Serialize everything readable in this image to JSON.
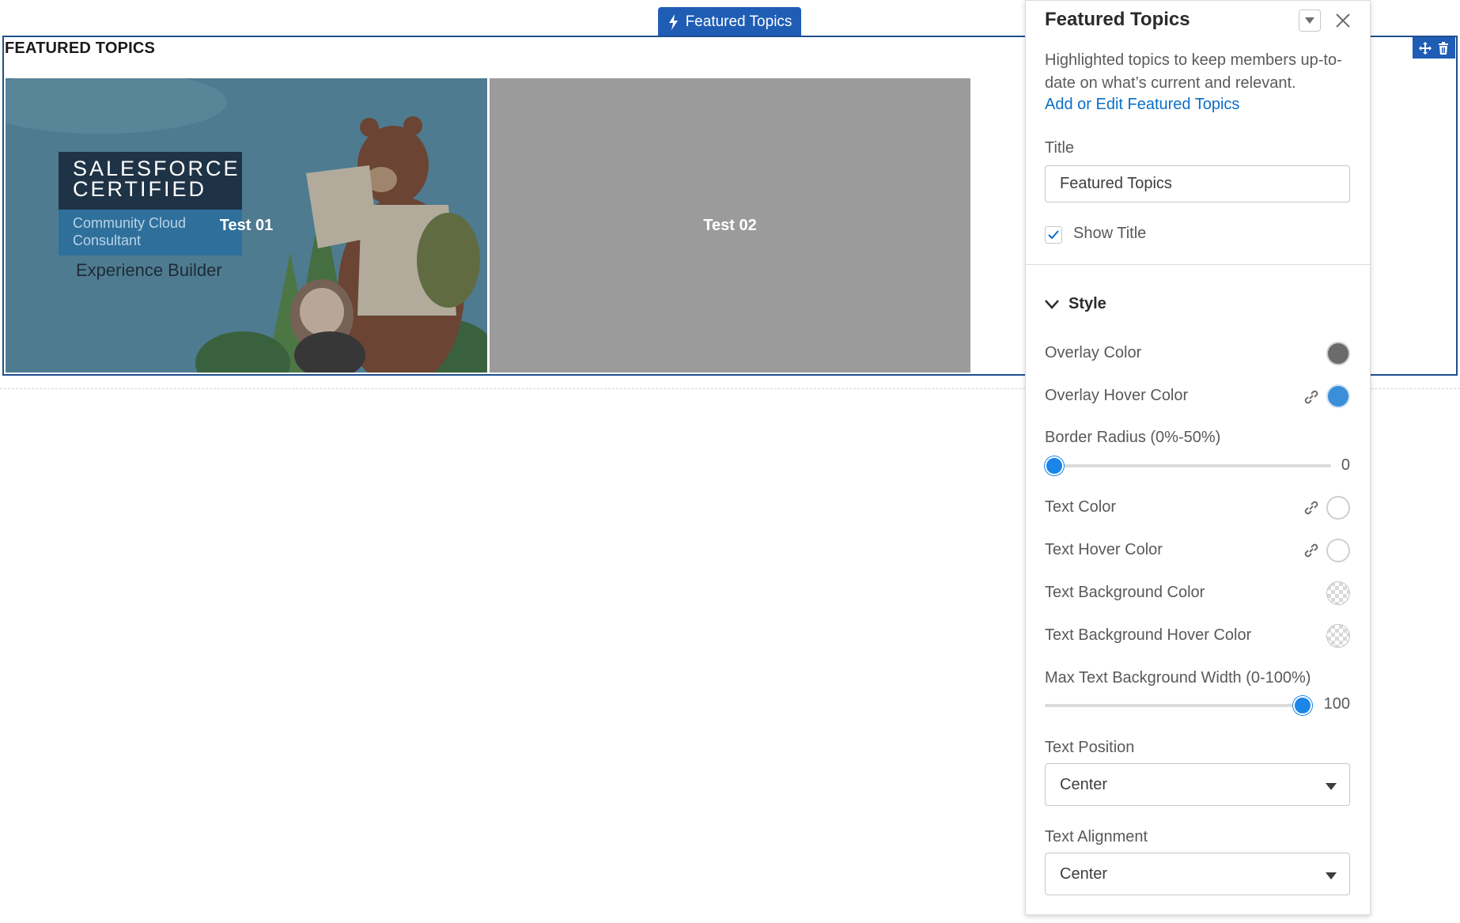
{
  "component_tab": {
    "label": "Featured Topics",
    "icon": "lightning-bolt-icon"
  },
  "canvas": {
    "heading": "FEATURED TOPICS",
    "tiles": [
      {
        "label": "Test 01",
        "image": "salesforce-certified-experience-builder"
      },
      {
        "label": "Test 02",
        "image": "none"
      }
    ],
    "certificate": {
      "line1": "SALESFORCE",
      "line2": "CERTIFIED",
      "line3": "Community Cloud",
      "line4": "Consultant",
      "subtitle": "Experience Builder"
    },
    "actions": [
      "move-icon",
      "trash-icon"
    ]
  },
  "panel": {
    "title": "Featured Topics",
    "description": "Highlighted topics to keep members up-to-date on what’s current and relevant.",
    "link": "Add or Edit Featured Topics",
    "title_label": "Title",
    "title_value": "Featured Topics",
    "show_title_label": "Show Title",
    "show_title_checked": true,
    "style_section": "Style",
    "overlay_color_label": "Overlay Color",
    "overlay_color": "#6b6b6b",
    "overlay_hover_color_label": "Overlay Hover Color",
    "overlay_hover_color": "#3a8fd8",
    "border_radius_label": "Border Radius (0%-50%)",
    "border_radius_value": "0",
    "text_color_label": "Text Color",
    "text_color": "#ffffff",
    "text_hover_color_label": "Text Hover Color",
    "text_hover_color": "#ffffff",
    "text_bg_color_label": "Text Background Color",
    "text_bg_hover_color_label": "Text Background Hover Color",
    "max_text_bg_width_label": "Max Text Background Width (0-100%)",
    "max_text_bg_width_value": "100",
    "text_position_label": "Text Position",
    "text_position_value": "Center",
    "text_alignment_label": "Text Alignment",
    "text_alignment_value": "Center"
  }
}
